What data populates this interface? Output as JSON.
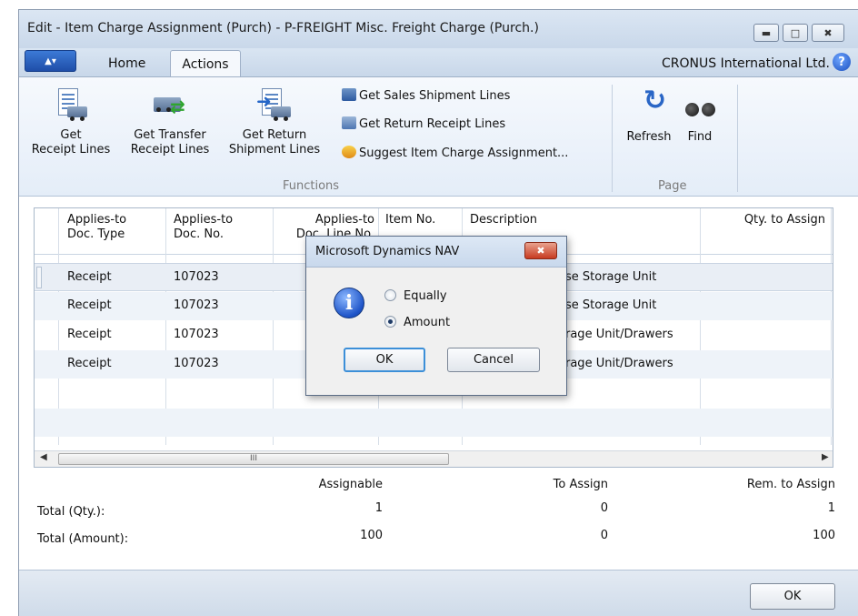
{
  "window": {
    "title": "Edit - Item Charge Assignment (Purch) - P-FREIGHT Misc. Freight Charge (Purch.)",
    "company": "CRONUS International Ltd."
  },
  "ribbon": {
    "tabs": [
      {
        "label": "Home"
      },
      {
        "label": "Actions"
      }
    ],
    "active_tab": "Actions",
    "functions": {
      "group_label": "Functions",
      "get_receipt_lines": {
        "line1": "Get",
        "line2": "Receipt Lines"
      },
      "get_transfer_receipt_lines": {
        "line1": "Get Transfer",
        "line2": "Receipt Lines"
      },
      "get_return_shipment_lines": {
        "line1": "Get Return",
        "line2": "Shipment Lines"
      },
      "get_sales_shipment_lines": "Get Sales Shipment Lines",
      "get_return_receipt_lines": "Get Return Receipt Lines",
      "suggest_item_charge_assignment": "Suggest Item Charge Assignment..."
    },
    "page": {
      "group_label": "Page",
      "refresh": "Refresh",
      "find": "Find"
    }
  },
  "grid": {
    "columns": [
      {
        "line1": "Applies-to",
        "line2": "Doc. Type"
      },
      {
        "line1": "Applies-to",
        "line2": "Doc. No."
      },
      {
        "line1": "Applies-to",
        "line2": "Doc. Line No."
      },
      {
        "line1": "Item No.",
        "line2": ""
      },
      {
        "line1": "Description",
        "line2": ""
      },
      {
        "line1": "Qty. to Assign",
        "line2": ""
      }
    ],
    "rows": [
      {
        "doc_type": "Receipt",
        "doc_no": "107023",
        "description": "Storage Unit",
        "desc_visible": "se Storage Unit"
      },
      {
        "doc_type": "Receipt",
        "doc_no": "107023",
        "description": "Storage Unit",
        "desc_visible": "se Storage Unit"
      },
      {
        "doc_type": "Receipt",
        "doc_no": "107023",
        "description": "Storage Unit/Drawers",
        "desc_visible": "rage Unit/Drawers"
      },
      {
        "doc_type": "Receipt",
        "doc_no": "107023",
        "description": "Storage Unit/Drawers",
        "desc_visible": "rage Unit/Drawers"
      }
    ],
    "scrollbar_glyph": "III"
  },
  "totals": {
    "headers": {
      "assignable": "Assignable",
      "to_assign": "To Assign",
      "rem_to_assign": "Rem. to Assign"
    },
    "qty": {
      "label": "Total (Qty.):",
      "assignable": "1",
      "to_assign": "0",
      "rem_to_assign": "1"
    },
    "amount": {
      "label": "Total (Amount):",
      "assignable": "100",
      "to_assign": "0",
      "rem_to_assign": "100"
    }
  },
  "footer": {
    "ok_label": "OK"
  },
  "dialog": {
    "title": "Microsoft Dynamics NAV",
    "options": [
      {
        "label": "Equally",
        "selected": false
      },
      {
        "label": "Amount",
        "selected": true
      }
    ],
    "ok_label": "OK",
    "cancel_label": "Cancel"
  },
  "colors": {
    "titlebar": "#c9d8ea",
    "ribbon": "#e4edf8",
    "selected_row": "#e9eef5",
    "dialog_close": "#c73a20",
    "info_icon": "#1e54c8"
  }
}
